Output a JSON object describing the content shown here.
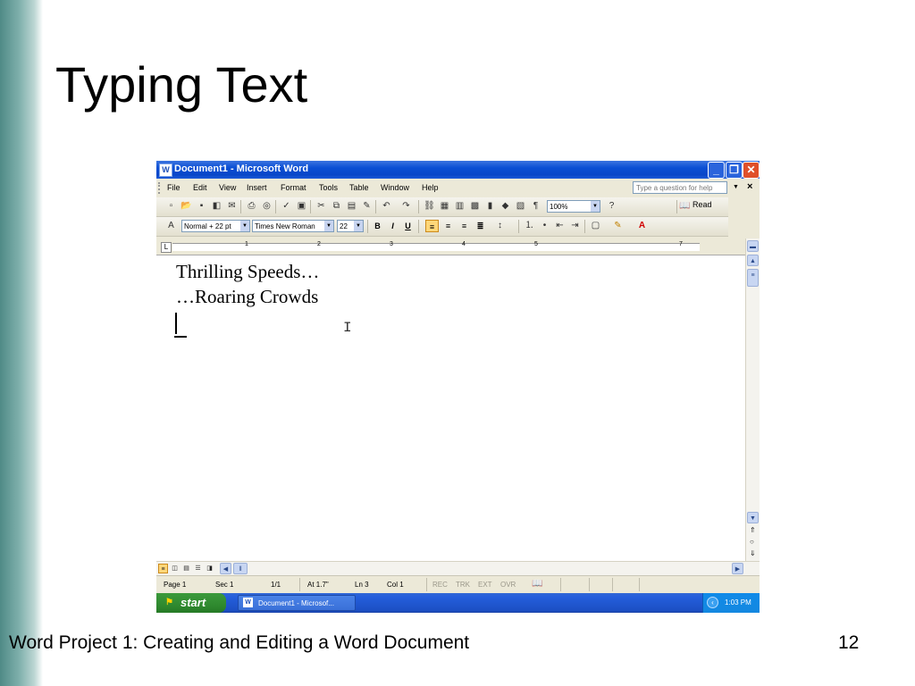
{
  "slide": {
    "title": "Typing Text",
    "footer": "Word Project 1: Creating and Editing a Word Document",
    "page_number": "12"
  },
  "window": {
    "title": "Document1 - Microsoft Word",
    "app_icon": "W"
  },
  "menu": {
    "items": [
      "File",
      "Edit",
      "View",
      "Insert",
      "Format",
      "Tools",
      "Table",
      "Window",
      "Help"
    ],
    "help_placeholder": "Type a question for help",
    "close_doc": "×"
  },
  "standard_toolbar": {
    "zoom": "100%",
    "read_label": "Read"
  },
  "formatting_toolbar": {
    "style": "Normal + 22 pt",
    "font": "Times New Roman",
    "size": "22",
    "bold": "B",
    "italic": "I",
    "underline": "U",
    "alignment": "left"
  },
  "ruler": {
    "numbers": [
      "1",
      "2",
      "3",
      "4",
      "5",
      "7"
    ]
  },
  "document": {
    "lines": [
      "Thrilling Speeds…",
      "…Roaring Crowds"
    ]
  },
  "status": {
    "page": "Page 1",
    "sec": "Sec 1",
    "pages": "1/1",
    "at": "At 1.7\"",
    "ln": "Ln 3",
    "col": "Col 1",
    "rec": "REC",
    "trk": "TRK",
    "ext": "EXT",
    "ovr": "OVR"
  },
  "taskbar": {
    "start": "start",
    "task_label": "Document1 - Microsof...",
    "clock": "1:03 PM"
  },
  "colors": {
    "title_bar": "#0a4fd4",
    "start_button": "#2f8a2f",
    "taskbar": "#245edc",
    "slide_accent": "#4f8a86"
  }
}
